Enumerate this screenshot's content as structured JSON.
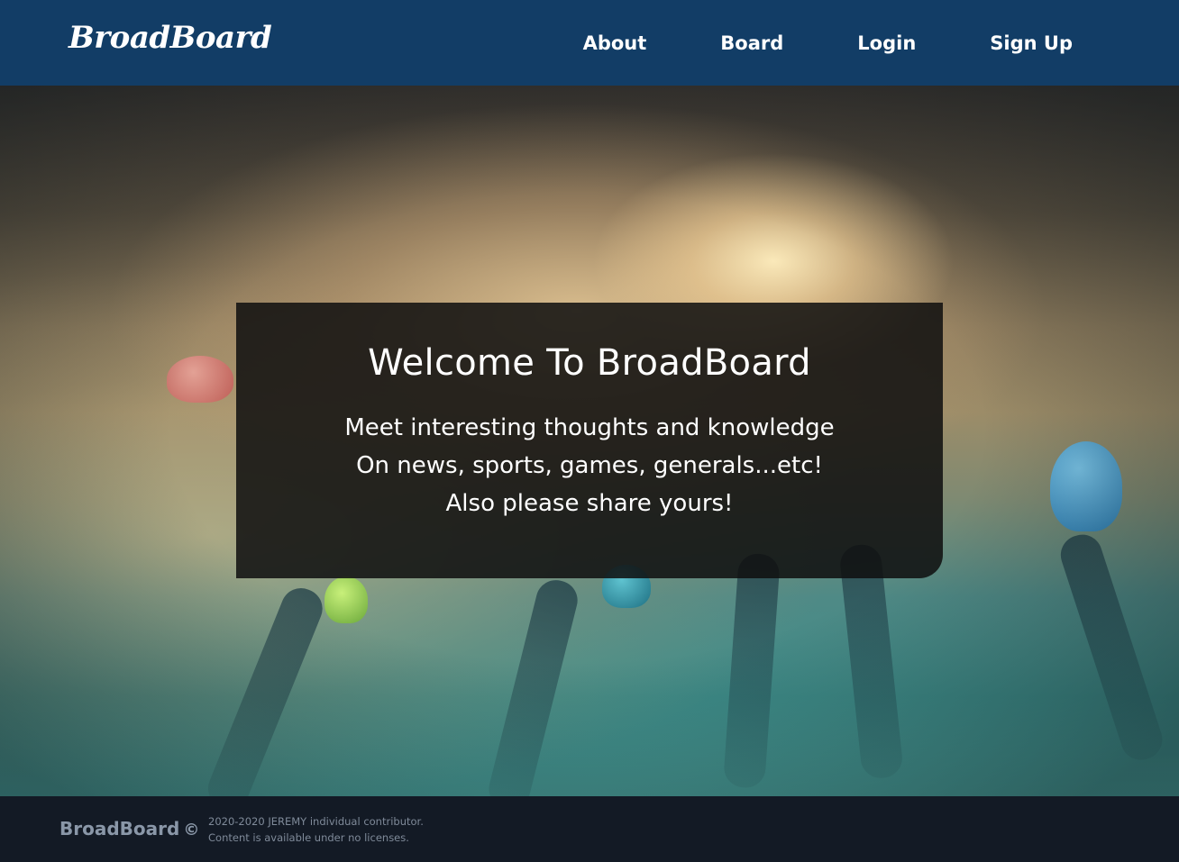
{
  "header": {
    "brand": "BroadBoard",
    "nav": [
      {
        "label": "About"
      },
      {
        "label": "Board"
      },
      {
        "label": "Login"
      },
      {
        "label": "Sign Up"
      }
    ]
  },
  "hero": {
    "title": "Welcome To BroadBoard",
    "lines": [
      "Meet interesting thoughts and knowledge",
      "On news, sports, games, generals...etc!",
      "Also please share yours!"
    ]
  },
  "footer": {
    "brand": "BroadBoard",
    "copyright_symbol": "©",
    "line1": "2020-2020 JEREMY individual contributor.",
    "line2": "Content is available under no licenses."
  },
  "colors": {
    "header_bg": "#123d66",
    "footer_bg": "#131a25",
    "card_bg": "rgba(15,15,15,0.86)"
  }
}
